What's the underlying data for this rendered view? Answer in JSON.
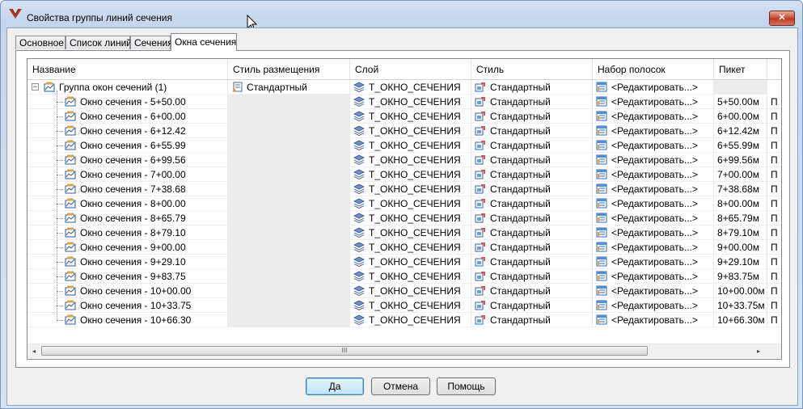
{
  "window": {
    "title": "Свойства группы линий сечения",
    "close_label": "✕"
  },
  "tabs": [
    {
      "label": "Основное",
      "active": false
    },
    {
      "label": "Список линий",
      "active": false
    },
    {
      "label": "Сечения",
      "active": false
    },
    {
      "label": "Окна сечения",
      "active": true
    }
  ],
  "grid": {
    "columns": [
      "Название",
      "Стиль размещения",
      "Слой",
      "Стиль",
      "Набор полосок",
      "Пикет"
    ],
    "group_row": {
      "name": "Группа окон сечений (1)",
      "placement_style": "Стандартный",
      "layer": "T_ОКНО_СЕЧЕНИЯ",
      "style": "Стандартный",
      "band_set": "<Редактировать...>",
      "station": ""
    },
    "rows": [
      {
        "name": "Окно сечения - 5+50.00",
        "layer": "T_ОКНО_СЕЧЕНИЯ",
        "style": "Стандартный",
        "band_set": "<Редактировать...>",
        "station": "5+50.00м",
        "extra": "П"
      },
      {
        "name": "Окно сечения - 6+00.00",
        "layer": "T_ОКНО_СЕЧЕНИЯ",
        "style": "Стандартный",
        "band_set": "<Редактировать...>",
        "station": "6+00.00м",
        "extra": "П"
      },
      {
        "name": "Окно сечения - 6+12.42",
        "layer": "T_ОКНО_СЕЧЕНИЯ",
        "style": "Стандартный",
        "band_set": "<Редактировать...>",
        "station": "6+12.42м",
        "extra": "П"
      },
      {
        "name": "Окно сечения - 6+55.99",
        "layer": "T_ОКНО_СЕЧЕНИЯ",
        "style": "Стандартный",
        "band_set": "<Редактировать...>",
        "station": "6+55.99м",
        "extra": "П"
      },
      {
        "name": "Окно сечения - 6+99.56",
        "layer": "T_ОКНО_СЕЧЕНИЯ",
        "style": "Стандартный",
        "band_set": "<Редактировать...>",
        "station": "6+99.56м",
        "extra": "П"
      },
      {
        "name": "Окно сечения - 7+00.00",
        "layer": "T_ОКНО_СЕЧЕНИЯ",
        "style": "Стандартный",
        "band_set": "<Редактировать...>",
        "station": "7+00.00м",
        "extra": "П"
      },
      {
        "name": "Окно сечения - 7+38.68",
        "layer": "T_ОКНО_СЕЧЕНИЯ",
        "style": "Стандартный",
        "band_set": "<Редактировать...>",
        "station": "7+38.68м",
        "extra": "П"
      },
      {
        "name": "Окно сечения - 8+00.00",
        "layer": "T_ОКНО_СЕЧЕНИЯ",
        "style": "Стандартный",
        "band_set": "<Редактировать...>",
        "station": "8+00.00м",
        "extra": "П"
      },
      {
        "name": "Окно сечения - 8+65.79",
        "layer": "T_ОКНО_СЕЧЕНИЯ",
        "style": "Стандартный",
        "band_set": "<Редактировать...>",
        "station": "8+65.79м",
        "extra": "П"
      },
      {
        "name": "Окно сечения - 8+79.10",
        "layer": "T_ОКНО_СЕЧЕНИЯ",
        "style": "Стандартный",
        "band_set": "<Редактировать...>",
        "station": "8+79.10м",
        "extra": "П"
      },
      {
        "name": "Окно сечения - 9+00.00",
        "layer": "T_ОКНО_СЕЧЕНИЯ",
        "style": "Стандартный",
        "band_set": "<Редактировать...>",
        "station": "9+00.00м",
        "extra": "П"
      },
      {
        "name": "Окно сечения - 9+29.10",
        "layer": "T_ОКНО_СЕЧЕНИЯ",
        "style": "Стандартный",
        "band_set": "<Редактировать...>",
        "station": "9+29.10м",
        "extra": "П"
      },
      {
        "name": "Окно сечения - 9+83.75",
        "layer": "T_ОКНО_СЕЧЕНИЯ",
        "style": "Стандартный",
        "band_set": "<Редактировать...>",
        "station": "9+83.75м",
        "extra": "П"
      },
      {
        "name": "Окно сечения - 10+00.00",
        "layer": "T_ОКНО_СЕЧЕНИЯ",
        "style": "Стандартный",
        "band_set": "<Редактировать...>",
        "station": "10+00.00м",
        "extra": "П"
      },
      {
        "name": "Окно сечения - 10+33.75",
        "layer": "T_ОКНО_СЕЧЕНИЯ",
        "style": "Стандартный",
        "band_set": "<Редактировать...>",
        "station": "10+33.75м",
        "extra": "П"
      },
      {
        "name": "Окно сечения - 10+66.30",
        "layer": "T_ОКНО_СЕЧЕНИЯ",
        "style": "Стандартный",
        "band_set": "<Редактировать...>",
        "station": "10+66.30м",
        "extra": "П"
      }
    ],
    "scrollbar": {
      "thumb_grip": "III",
      "left_arrow": "◂",
      "right_arrow": "▸"
    }
  },
  "buttons": {
    "ok": "Да",
    "cancel": "Отмена",
    "help": "Помощь"
  },
  "icons": {
    "app": "autocad-civil-icon",
    "group": "section-view-group-icon",
    "view": "section-view-icon",
    "layer": "layer-icon",
    "style": "style-icon",
    "band": "band-set-icon",
    "placement": "placement-style-icon"
  }
}
